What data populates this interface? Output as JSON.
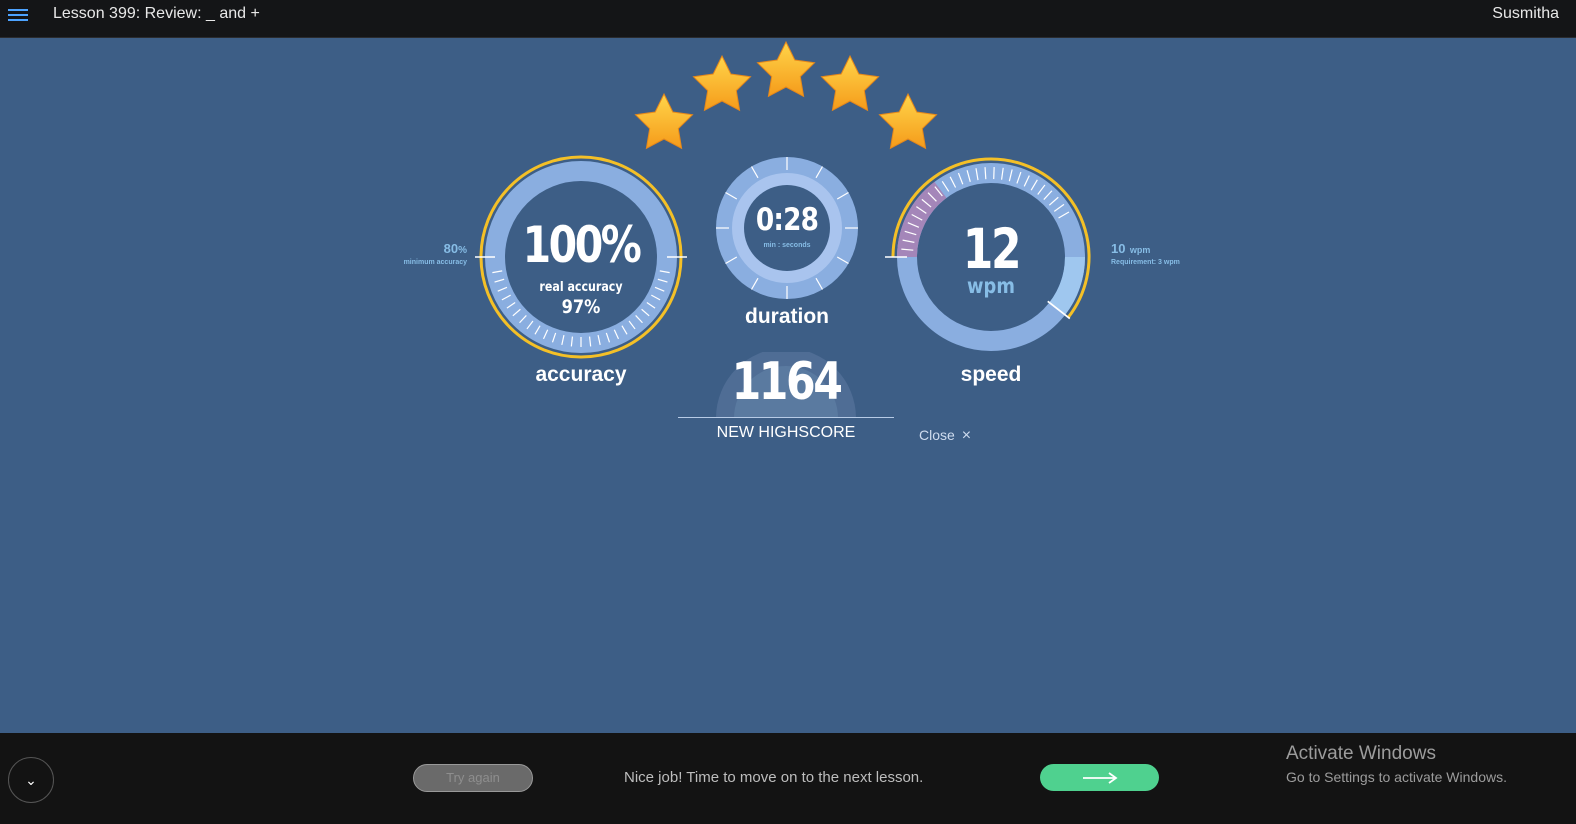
{
  "header": {
    "lesson_title": "Lesson 399: Review: _ and +",
    "username": "Susmitha",
    "menu_icon": "hamburger-menu-icon"
  },
  "stars": {
    "count": 5,
    "earned": 5
  },
  "accuracy": {
    "value": "100%",
    "real_accuracy_label": "real accuracy",
    "real_accuracy_value": "97%",
    "label": "accuracy",
    "minimum_value": "80",
    "minimum_unit": "%",
    "minimum_caption": "minimum accuracy"
  },
  "duration": {
    "value": "0:28",
    "unit": "min : seconds",
    "label": "duration"
  },
  "speed": {
    "value": "12",
    "unit": "wpm",
    "label": "speed",
    "target_value": "10",
    "target_unit": "wpm",
    "requirement": "Requirement: 3 wpm"
  },
  "score": {
    "value": "1164",
    "caption": "NEW HIGHSCORE",
    "close_label": "Close",
    "close_icon": "×"
  },
  "footer": {
    "collapse_icon": "⌄",
    "try_again_label": "Try again",
    "message": "Nice job! Time to move on to the next lesson.",
    "next_icon": "arrow-right-icon",
    "activate_title": "Activate Windows",
    "activate_sub": "Go to Settings to activate Windows."
  },
  "colors": {
    "background": "#3d5e86",
    "gauge_light": "#8aaee0",
    "gauge_dark": "#3d5e86",
    "gold": "#f4c027",
    "accent_text": "#87bde6",
    "next_button": "#4fd18f"
  }
}
